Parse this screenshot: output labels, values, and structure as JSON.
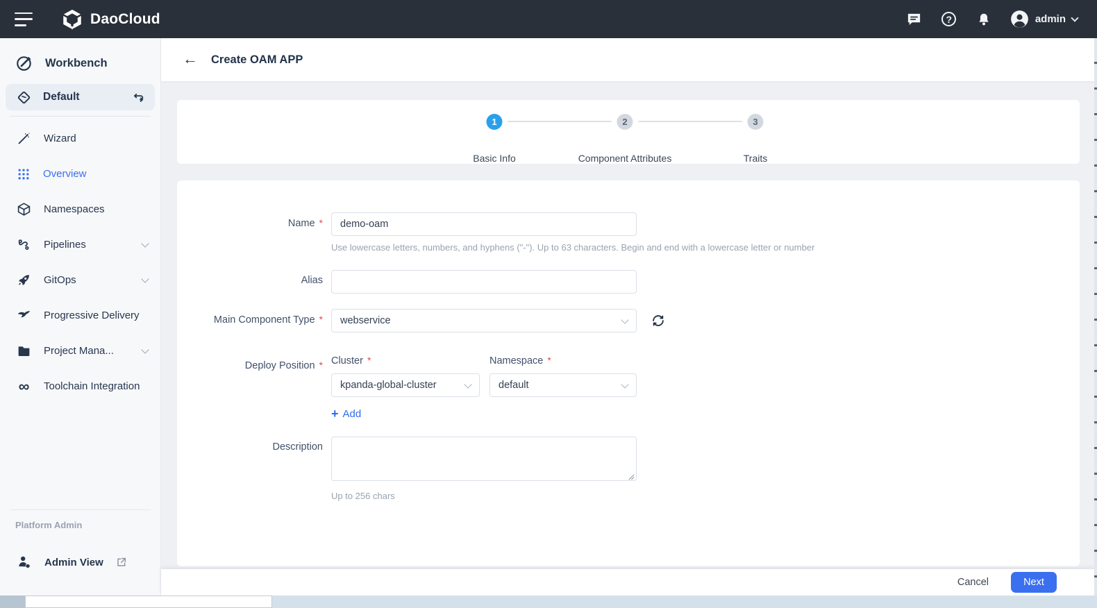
{
  "topbar": {
    "brand": "DaoCloud",
    "user": "admin",
    "help_glyph": "?"
  },
  "sidebar": {
    "workbench_label": "Workbench",
    "workspace": {
      "label": "Default"
    },
    "items": [
      {
        "label": "Wizard"
      },
      {
        "label": "Overview"
      },
      {
        "label": "Namespaces"
      },
      {
        "label": "Pipelines"
      },
      {
        "label": "GitOps"
      },
      {
        "label": "Progressive Delivery"
      },
      {
        "label": "Project Mana..."
      },
      {
        "label": "Toolchain Integration"
      }
    ],
    "toolchain_glyph": "∞",
    "section_label": "Platform Admin",
    "admin_view_label": "Admin View"
  },
  "header": {
    "back_glyph": "←",
    "title": "Create OAM APP"
  },
  "stepper": {
    "steps": [
      {
        "num": "1",
        "label": "Basic Info"
      },
      {
        "num": "2",
        "label": "Component Attributes"
      },
      {
        "num": "3",
        "label": "Traits"
      }
    ]
  },
  "form": {
    "name": {
      "label": "Name",
      "value": "demo-oam",
      "hint": "Use lowercase letters, numbers, and hyphens (\"-\"). Up to 63 characters. Begin and end with a lowercase letter or number"
    },
    "alias": {
      "label": "Alias",
      "value": ""
    },
    "main_component_type": {
      "label": "Main Component Type",
      "value": "webservice"
    },
    "deploy_position": {
      "label": "Deploy Position",
      "cluster": {
        "label": "Cluster",
        "value": "kpanda-global-cluster"
      },
      "namespace": {
        "label": "Namespace",
        "value": "default"
      },
      "add_label": "Add",
      "add_glyph": "+"
    },
    "description": {
      "label": "Description",
      "value": "",
      "hint": "Up to 256 chars"
    }
  },
  "footer": {
    "cancel_label": "Cancel",
    "next_label": "Next"
  },
  "misc": {
    "required_marker": "*"
  },
  "colors": {
    "topbar_bg": "#2a3039",
    "accent_blue": "#3a6ff0",
    "step_active_blue": "#2aa0ec",
    "required_red": "#e5484d",
    "content_bg": "#eef0f3"
  }
}
